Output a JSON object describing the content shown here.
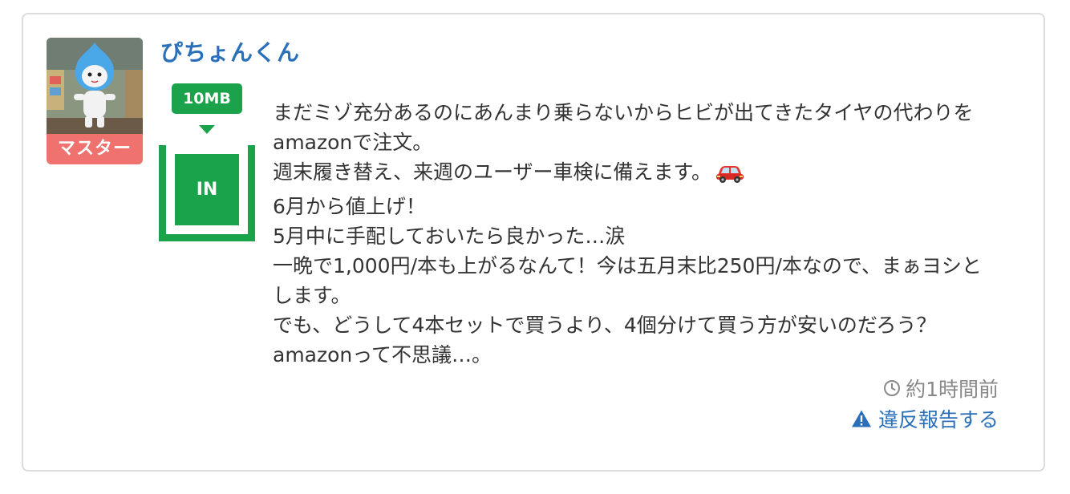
{
  "user": {
    "name": "ぴちょんくん",
    "role": "マスター",
    "size_badge": "10MB",
    "status": "IN"
  },
  "post": {
    "lines": [
      "まだミゾ充分あるのにあんまり乗らないからヒビが出てきたタイヤの代わりをamazonで注文。",
      "週末履き替え、来週のユーザー車検に備えます。",
      "6月から値上げ！",
      "5月中に手配しておいたら良かった…涙",
      "一晩で1,000円/本も上がるなんて！今は五月末比250円/本なので、まぁヨシとします。",
      "でも、どうして4本セットで買うより、4個分けて買う方が安いのだろう？amazonって不思議…。"
    ],
    "line2_icon": "car-icon"
  },
  "meta": {
    "time": "約1時間前",
    "time_icon": "clock-icon",
    "report_label": "違反報告する",
    "report_icon": "warning-icon"
  },
  "colors": {
    "name": "#2a6fba",
    "role_badge": "#f0726f",
    "status_green": "#1aa34a",
    "meta_gray": "#888888"
  }
}
